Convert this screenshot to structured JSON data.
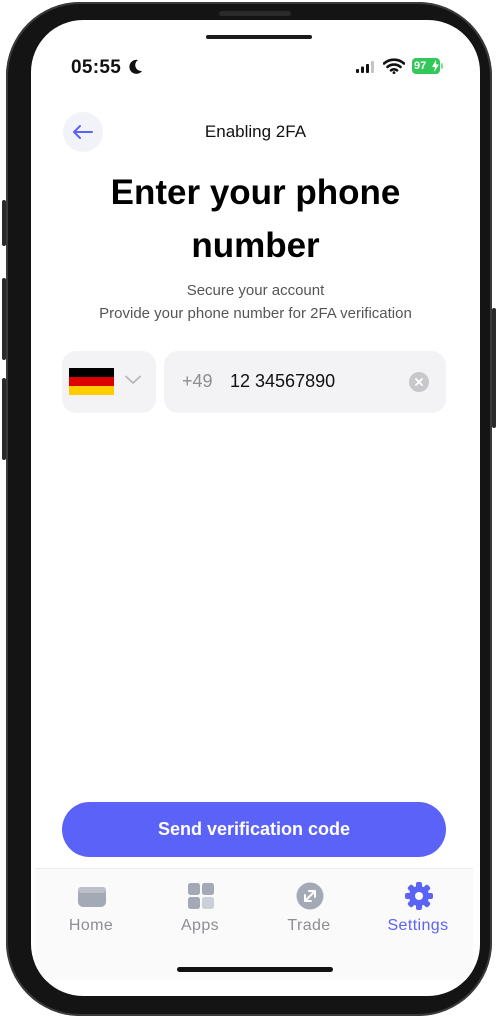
{
  "status_bar": {
    "time": "05:55",
    "battery": "97"
  },
  "header": {
    "title": "Enabling 2FA"
  },
  "main": {
    "title": "Enter your phone number",
    "subtitle_line1": "Secure your account",
    "subtitle_line2": "Provide your phone number for 2FA verification",
    "country": {
      "flag": "germany-flag",
      "flag_colors": [
        "#000000",
        "#dd0000",
        "#ffcc00"
      ]
    },
    "phone": {
      "dial_code": "+49",
      "value": "12 34567890"
    },
    "send_button_label": "Send verification code"
  },
  "tab_bar": {
    "items": [
      {
        "label": "Home",
        "icon": "wallet-icon"
      },
      {
        "label": "Apps",
        "icon": "apps-grid-icon"
      },
      {
        "label": "Trade",
        "icon": "trade-icon"
      },
      {
        "label": "Settings",
        "icon": "gear-icon"
      }
    ],
    "active": "Settings"
  },
  "colors": {
    "accent": "#5b62f7",
    "battery": "#34c759",
    "inactive_tab": "#8e8e93"
  }
}
